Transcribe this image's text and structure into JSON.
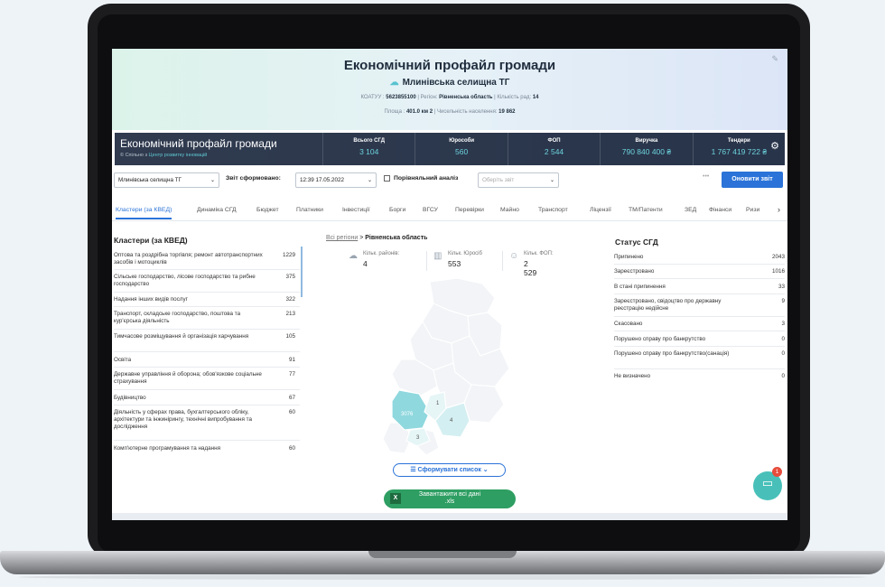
{
  "hero": {
    "title": "Економічний профайл громади",
    "community": "Млинівська селищна ТГ",
    "meta1_k1": "КОАТУУ :",
    "meta1_v1": "5623855100",
    "meta1_k2": "| Регіон:",
    "meta1_v2": "Рівненська область",
    "meta1_k3": "| Кількість рад:",
    "meta1_v3": "14",
    "meta2_k1": "Площа :",
    "meta2_v1": "401.0 км 2",
    "meta2_k2": "| Чисельність населення:",
    "meta2_v2": "19 862"
  },
  "statbar": {
    "brand": "Економічний профайл громади",
    "copyright": "© Спільно з",
    "copyright_link": "Центр розвитку інновацій",
    "stats": [
      {
        "label": "Всього СГД",
        "value": "3 104"
      },
      {
        "label": "Юрособи",
        "value": "560"
      },
      {
        "label": "ФОП",
        "value": "2 544"
      },
      {
        "label": "Виручка",
        "value": "790 840 400 ₴"
      },
      {
        "label": "Тендери",
        "value": "1 767 419 722 ₴"
      }
    ]
  },
  "controls": {
    "community_select": "Млинівська селищна ТГ",
    "report_label": "Звіт сформовано:",
    "report_date": "12:39 17.05.2022",
    "compare_label": "Порівняльний аналіз",
    "report_placeholder": "Оберіть звіт",
    "dots": "•••",
    "update_button": "Оновити звіт"
  },
  "tabs": [
    "Кластери (за КВЕД)",
    "Динаміка СГД",
    "Бюджет",
    "Платники",
    "Інвестиції",
    "Борги",
    "ВГСУ",
    "Перевірки",
    "Майно",
    "Транспорт",
    "Ліцензії",
    "ТМ/Патенти",
    "ЗЕД",
    "Фінанси",
    "Ризи"
  ],
  "clusters": {
    "title": "Кластери (за КВЕД)",
    "rows": [
      {
        "label": "Оптова та роздрібна торгівля; ремонт автотранспортних засобів і мотоциклів",
        "value": "1229"
      },
      {
        "label": "Сільське господарство, лісове господарство та рибне господарство",
        "value": "375"
      },
      {
        "label": "Надання інших видів послуг",
        "value": "322"
      },
      {
        "label": "Транспорт, складське господарство, поштова та кур'єрська діяльність",
        "value": "213"
      },
      {
        "label": "Тимчасове розміщування й організація харчування",
        "value": "105"
      },
      {
        "label": "Освіта",
        "value": "91"
      },
      {
        "label": "Державне управління й оборона; обов'язкове соціальне страхування",
        "value": "77"
      },
      {
        "label": "Будівництво",
        "value": "67"
      },
      {
        "label": "Діяльність у сферах права, бухгалтерського обліку, архітектури та інжинірингу, технічні випробування та дослідження",
        "value": "60"
      },
      {
        "label": "Комп'ютерне програмування та надання",
        "value": "60"
      }
    ]
  },
  "region": {
    "all": "Всі регіони",
    "sep": ">",
    "current": "Рівненська область",
    "stats": [
      {
        "label": "Кільк. районів:",
        "value": "4"
      },
      {
        "label": "Кільк. Юросіб",
        "value": "553"
      },
      {
        "label": "Кільк. ФОП:",
        "value": "2 529"
      }
    ],
    "map_labels": [
      "3076",
      "1",
      "4",
      "3"
    ],
    "list_button": "Сформувати список",
    "download_button_l1": "Завантажити всі дані",
    "download_button_l2": ".xls"
  },
  "status": {
    "title": "Статус СГД",
    "rows": [
      {
        "label": "Припинено",
        "value": "2043"
      },
      {
        "label": "Зареєстровано",
        "value": "1016"
      },
      {
        "label": "В стані припинення",
        "value": "33"
      },
      {
        "label": "Зареєстровано, свідоцтво про державну реєстрацію недійсне",
        "value": "9"
      },
      {
        "label": "Скасовано",
        "value": "3"
      },
      {
        "label": "Порушено справу про банкрутство",
        "value": "0"
      },
      {
        "label": "Порушено справу про банкрутство(санація)",
        "value": "0"
      },
      {
        "label": "Не визначено",
        "value": "0"
      }
    ]
  },
  "chat": {
    "badge": "1"
  },
  "colors": {
    "accent": "#2b73d8",
    "teal": "#48c0b9",
    "excel": "#2e9e62",
    "statbar": "#303b4f"
  }
}
